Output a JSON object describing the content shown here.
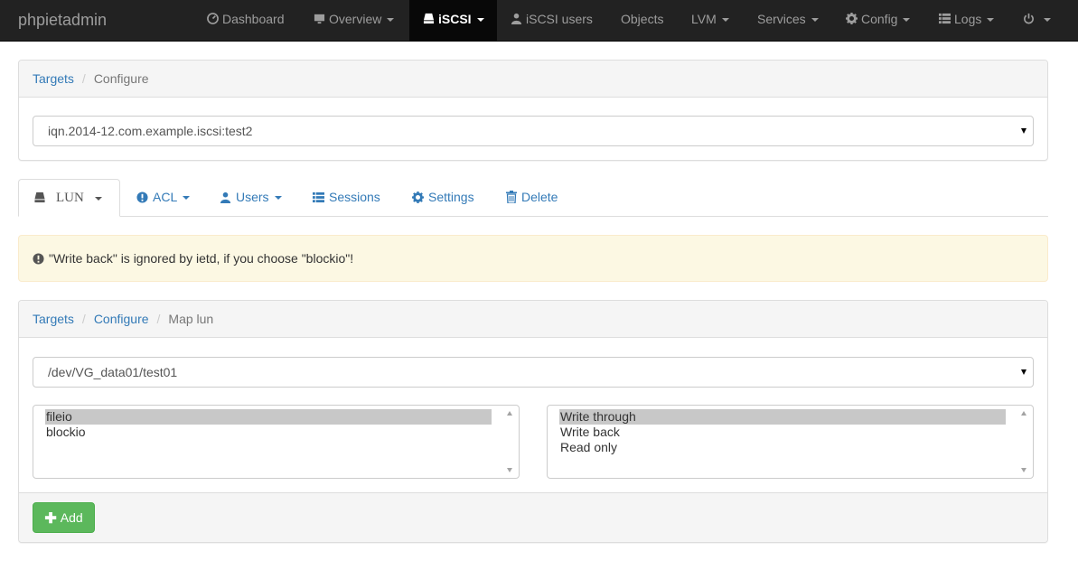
{
  "navbar": {
    "brand": "phpietadmin",
    "items": [
      {
        "label": "Dashboard",
        "icon": "dashboard-icon",
        "dropdown": false
      },
      {
        "label": "Overview",
        "icon": "monitor-icon",
        "dropdown": true
      },
      {
        "label": "iSCSI",
        "icon": "harddisk-icon",
        "dropdown": true,
        "active": true
      },
      {
        "label": "iSCSI users",
        "icon": "user-icon",
        "dropdown": false
      },
      {
        "label": "Objects",
        "icon": "",
        "dropdown": false
      },
      {
        "label": "LVM",
        "icon": "",
        "dropdown": true
      },
      {
        "label": "Services",
        "icon": "",
        "dropdown": true
      },
      {
        "label": "Config",
        "icon": "gear-icon",
        "dropdown": true
      },
      {
        "label": "Logs",
        "icon": "list-icon",
        "dropdown": true
      },
      {
        "label": "",
        "icon": "power-icon",
        "dropdown": true
      }
    ]
  },
  "target_panel": {
    "breadcrumb": [
      "Targets",
      "Configure"
    ],
    "selected_target": "iqn.2014-12.com.example.iscsi:test2"
  },
  "tabs": [
    {
      "label": "LUN",
      "icon": "harddisk-icon",
      "dropdown": true,
      "active": true
    },
    {
      "label": "ACL",
      "icon": "exclamation-circle-icon",
      "dropdown": true
    },
    {
      "label": "Users",
      "icon": "user-icon",
      "dropdown": true
    },
    {
      "label": "Sessions",
      "icon": "list-icon",
      "dropdown": false
    },
    {
      "label": "Settings",
      "icon": "gear-icon",
      "dropdown": false
    },
    {
      "label": "Delete",
      "icon": "trash-icon",
      "dropdown": false
    }
  ],
  "alert": {
    "message": "\"Write back\" is ignored by ietd, if you choose \"blockio\"!"
  },
  "map_panel": {
    "breadcrumb": [
      "Targets",
      "Configure",
      "Map lun"
    ],
    "selected_device": "/dev/VG_data01/test01",
    "type_options": [
      "fileio",
      "blockio"
    ],
    "type_selected": "fileio",
    "mode_options": [
      "Write through",
      "Write back",
      "Read only"
    ],
    "mode_selected": "Write through",
    "add_label": "Add"
  },
  "colors": {
    "navbar_bg": "#222222",
    "link": "#337ab7",
    "success": "#5cb85c",
    "warning_bg": "#fcf8e3"
  }
}
